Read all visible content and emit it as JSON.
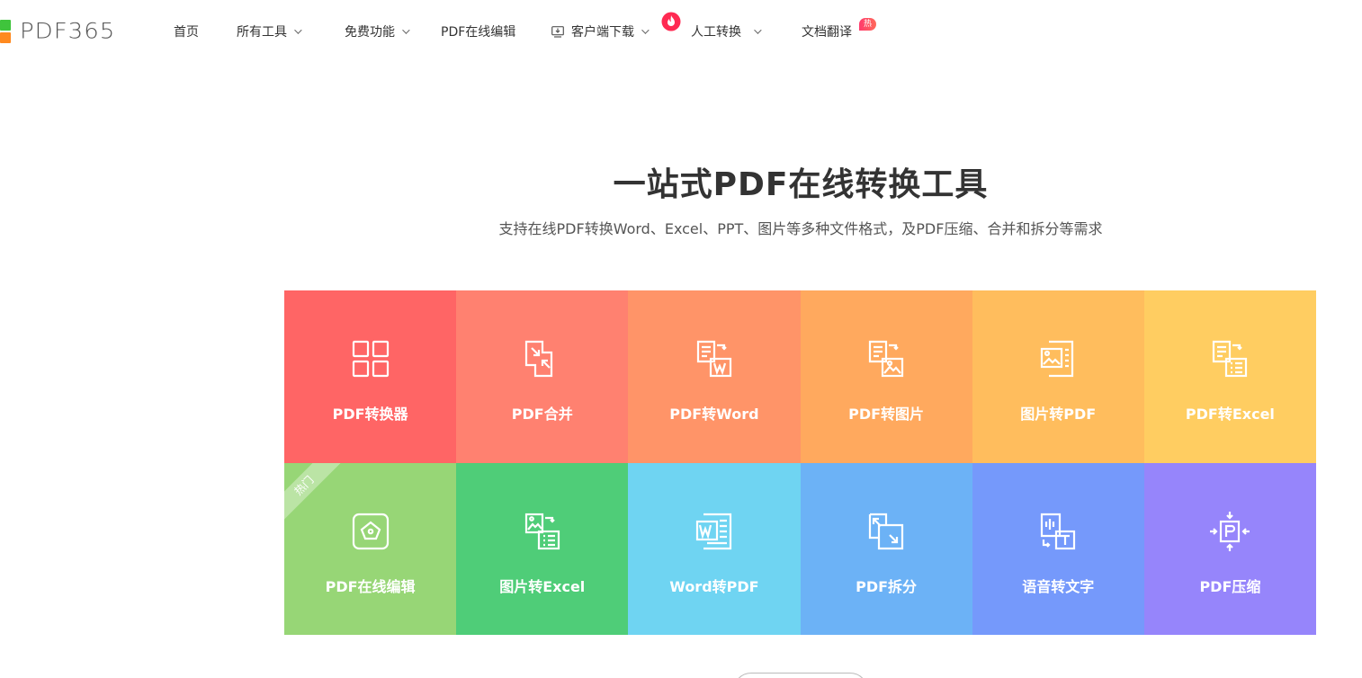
{
  "header": {
    "logo_text": "PDF365",
    "nav": [
      {
        "label": "首页"
      },
      {
        "label": "所有工具"
      },
      {
        "label": "免费功能"
      },
      {
        "label": "PDF在线编辑"
      },
      {
        "label": "客户端下载"
      },
      {
        "label": "人工转换"
      },
      {
        "label": "文档翻译"
      }
    ],
    "hot_badge": "热门"
  },
  "hero": {
    "title": "一站式PDF在线转换工具",
    "subtitle": "支持在线PDF转换Word、Excel、PPT、图片等多种文件格式，及PDF压缩、合并和拆分等需求"
  },
  "tools": [
    {
      "label": "PDF转换器",
      "color": "#ff6565",
      "icon": "grid-icon"
    },
    {
      "label": "PDF合并",
      "color": "#ff8170",
      "icon": "merge-icon"
    },
    {
      "label": "PDF转Word",
      "color": "#ff9468",
      "icon": "pdf-to-word-icon"
    },
    {
      "label": "PDF转图片",
      "color": "#ffa95e",
      "icon": "pdf-to-image-icon"
    },
    {
      "label": "图片转PDF",
      "color": "#ffbd5d",
      "icon": "image-to-pdf-icon"
    },
    {
      "label": "PDF转Excel",
      "color": "#ffcd61",
      "icon": "pdf-to-excel-icon"
    },
    {
      "label": "PDF在线编辑",
      "color": "#97d676",
      "icon": "edit-icon",
      "ribbon": "热门"
    },
    {
      "label": "图片转Excel",
      "color": "#4fcd78",
      "icon": "image-to-excel-icon"
    },
    {
      "label": "Word转PDF",
      "color": "#6fd4f2",
      "icon": "word-to-pdf-icon"
    },
    {
      "label": "PDF拆分",
      "color": "#6cb2f6",
      "icon": "split-icon"
    },
    {
      "label": "语音转文字",
      "color": "#7599fb",
      "icon": "speech-to-text-icon"
    },
    {
      "label": "PDF压缩",
      "color": "#9685fb",
      "icon": "compress-icon"
    }
  ]
}
